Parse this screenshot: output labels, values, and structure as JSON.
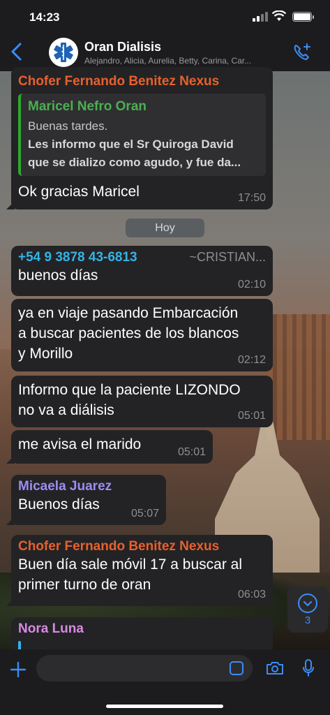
{
  "status": {
    "time": "14:23"
  },
  "header": {
    "title": "Oran Dialisis",
    "members": "Alejandro, Alicia, Aurelia, Betty, Carina, Car..."
  },
  "date_separator": "Hoy",
  "messages": [
    {
      "sender": "Chofer Fernando Benitez Nexus",
      "sender_color": "#e8602c",
      "quote": {
        "name": "Maricel  Nefro Oran",
        "line1": "Buenas tardes.",
        "line2": "Les informo que el Sr Quiroga David",
        "line3": "que se dializo como agudo, y fue da..."
      },
      "text": "Ok gracias Maricel",
      "time": "17:50"
    },
    {
      "sender": "+54 9 3878 43-6813",
      "sender_alias": "~CRISTIAN...",
      "sender_color": "#35b3e6",
      "text": "buenos días",
      "time": "02:10"
    },
    {
      "line1": "ya en viaje pasando Embarcación",
      "line2": "a buscar pacientes de los blancos",
      "line3": "y Morillo",
      "time": "02:12"
    },
    {
      "line1": "Informo que la paciente LIZONDO",
      "line2": "no va a diálisis",
      "time": "05:01"
    },
    {
      "text": "me avisa el marido",
      "time": "05:01"
    },
    {
      "sender": "Micaela Juarez",
      "sender_color": "#9b8ef0",
      "text": "Buenos días",
      "time": "05:07"
    },
    {
      "sender": "Chofer Fernando Benitez Nexus",
      "sender_color": "#e8602c",
      "line1": "Buen día sale móvil 17 a buscar al",
      "line2": "primer turno de oran",
      "time": "06:03"
    },
    {
      "sender": "Nora Luna",
      "sender_color": "#d78be0"
    }
  ],
  "scroll": {
    "unread_count": "3"
  },
  "icons": {
    "back": "chevron-left-icon",
    "avatar": "star-of-life-icon",
    "call": "add-call-icon",
    "plus": "plus-icon",
    "sticker": "sticker-icon",
    "camera": "camera-icon",
    "mic": "microphone-icon"
  },
  "colors": {
    "accent": "#3d8cf7",
    "bubble": "#232325"
  }
}
